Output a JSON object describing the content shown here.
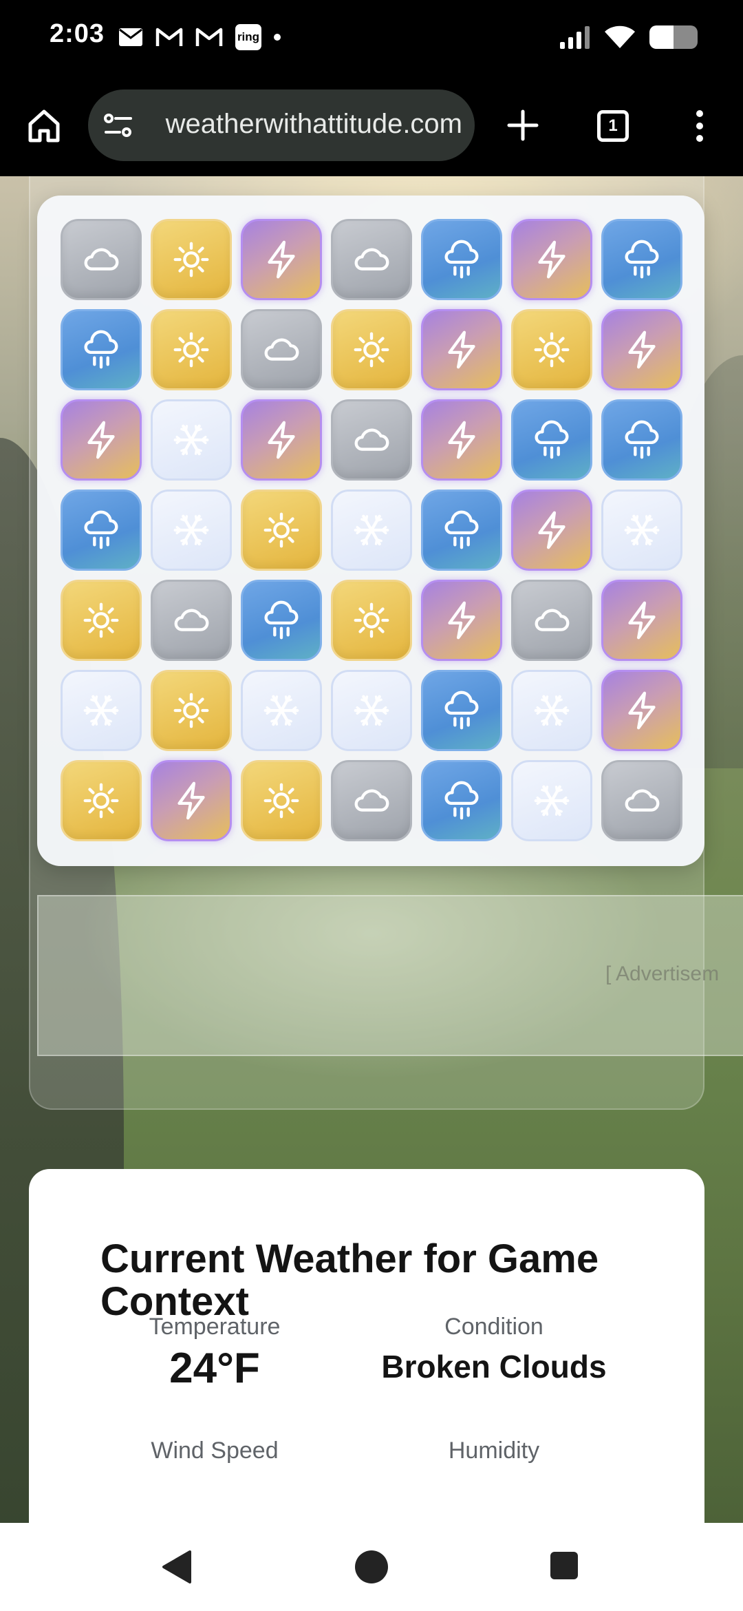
{
  "status_bar": {
    "time": "2:03",
    "ring_badge": "ring",
    "icons": [
      "email-icon",
      "gmail-icon",
      "gmail-icon",
      "ring-icon",
      "notification-dot",
      "signal-icon",
      "wifi-icon",
      "battery-icon"
    ],
    "battery_level": 0.5
  },
  "browser": {
    "url": "weatherwithattitude.com",
    "tab_count": "1"
  },
  "game": {
    "grid": [
      [
        "cloud",
        "sun",
        "bolt",
        "cloud",
        "rain",
        "bolt",
        "rain"
      ],
      [
        "rain",
        "sun",
        "cloud",
        "sun",
        "bolt",
        "sun",
        "bolt"
      ],
      [
        "bolt",
        "snow",
        "bolt",
        "cloud",
        "bolt",
        "rain",
        "rain"
      ],
      [
        "rain",
        "snow",
        "sun",
        "snow",
        "rain",
        "bolt",
        "snow"
      ],
      [
        "sun",
        "cloud",
        "rain",
        "sun",
        "bolt",
        "cloud",
        "bolt"
      ],
      [
        "snow",
        "sun",
        "snow",
        "snow",
        "rain",
        "snow",
        "bolt"
      ],
      [
        "sun",
        "bolt",
        "sun",
        "cloud",
        "rain",
        "snow",
        "cloud"
      ]
    ],
    "tile_icons": {
      "cloud": "cloud-icon",
      "sun": "sun-icon",
      "bolt": "lightning-icon",
      "rain": "rain-icon",
      "snow": "snowflake-icon"
    }
  },
  "ad": {
    "label": "[ Advertisem"
  },
  "weather": {
    "title": "Current Weather for Game Context",
    "temperature_label": "Temperature",
    "temperature_value": "24°F",
    "condition_label": "Condition",
    "condition_value": "Broken Clouds",
    "wind_label": "Wind Speed",
    "humidity_label": "Humidity"
  }
}
